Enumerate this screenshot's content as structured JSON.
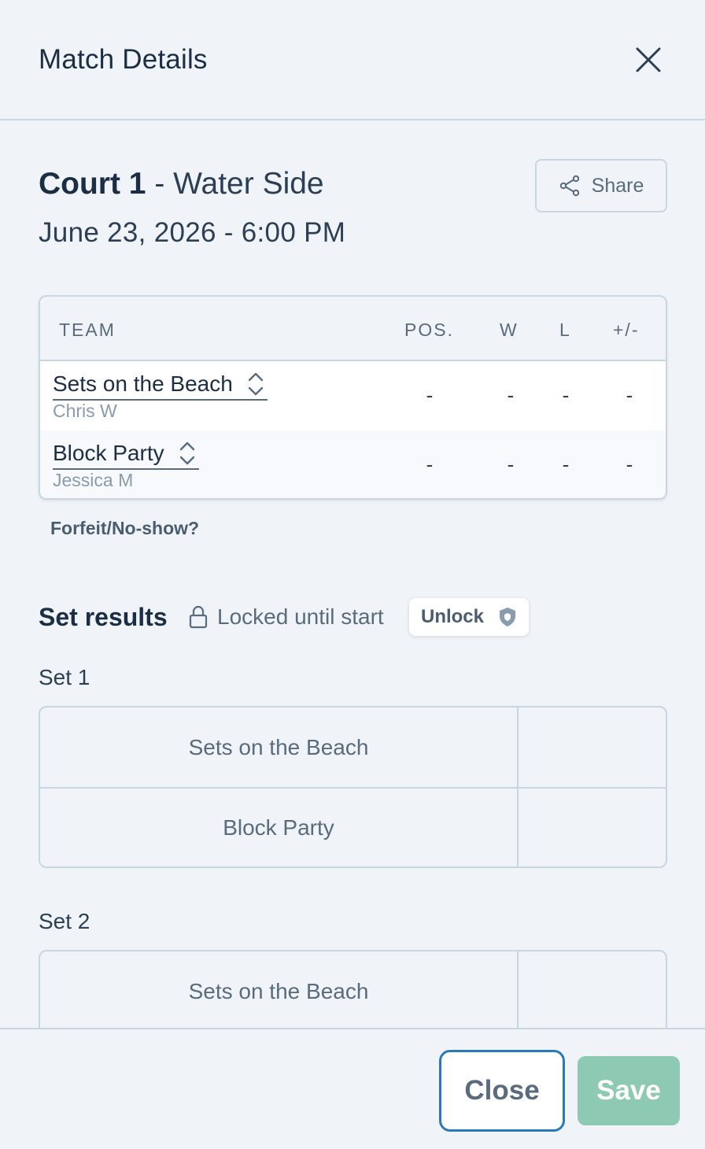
{
  "header": {
    "title": "Match Details"
  },
  "match": {
    "court": "Court 1",
    "court_sub": "- Water Side",
    "datetime": "June 23, 2026 - 6:00 PM",
    "share_label": "Share"
  },
  "table": {
    "headers": {
      "team": "TEAM",
      "pos": "POS.",
      "w": "W",
      "l": "L",
      "pm": "+/-"
    },
    "rows": [
      {
        "team": "Sets on the Beach",
        "player": "Chris W",
        "pos": "-",
        "w": "-",
        "l": "-",
        "pm": "-"
      },
      {
        "team": "Block Party",
        "player": "Jessica M",
        "pos": "-",
        "w": "-",
        "l": "-",
        "pm": "-"
      }
    ]
  },
  "forfeit_label": "Forfeit/No-show?",
  "set_results": {
    "title": "Set results",
    "locked_text": "Locked until start",
    "unlock_label": "Unlock",
    "sets": [
      {
        "label": "Set 1",
        "teams": [
          "Sets on the Beach",
          "Block Party"
        ]
      },
      {
        "label": "Set 2",
        "teams": [
          "Sets on the Beach"
        ]
      }
    ]
  },
  "footer": {
    "close_label": "Close",
    "save_label": "Save"
  },
  "colors": {
    "background": "#f0f4f8",
    "border": "#c9d6e2",
    "text_primary": "#1b2e44",
    "text_muted": "#5a6b7e",
    "close_border": "#2a7ab8",
    "save_bg": "#8ec9b4"
  }
}
